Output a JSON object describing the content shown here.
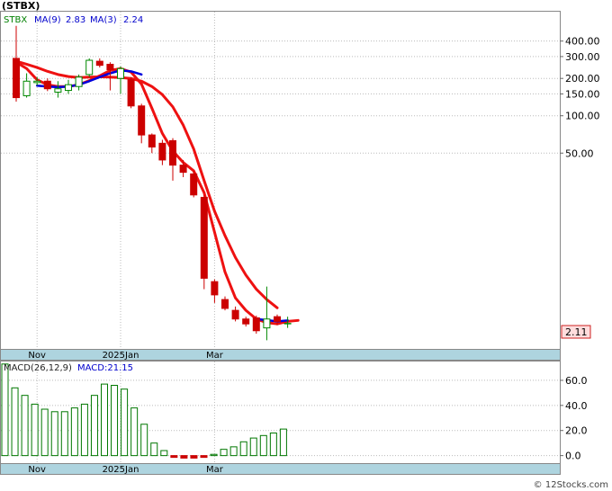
{
  "chart_data": [
    {
      "type": "candlestick",
      "title": "(STBX)",
      "legend": [
        {
          "label": "STBX",
          "value": "",
          "color": "#008000"
        },
        {
          "label": "MA(9)",
          "value": "2.83",
          "color": "#0000cc"
        },
        {
          "label": "MA(3)",
          "value": "2.24",
          "color": "#0000cc"
        }
      ],
      "y_scale": "log",
      "ylim": [
        1.32,
        690
      ],
      "y_ticks": [
        400,
        300,
        200,
        150,
        100,
        50
      ],
      "y_tick_labels": [
        "400.00",
        "300.00",
        "200.00",
        "150.00",
        "100.00",
        "50.00"
      ],
      "current_price_label": "2.11",
      "x_tick_labels": [
        {
          "label": "Nov",
          "bar": 2
        },
        {
          "label": "2025Jan",
          "bar": 10
        },
        {
          "label": "Mar",
          "bar": 19
        }
      ],
      "candles": [
        {
          "o": 290,
          "h": 530,
          "l": 130,
          "c": 140,
          "dir": "down"
        },
        {
          "o": 145,
          "h": 220,
          "l": 140,
          "c": 190,
          "dir": "up"
        },
        {
          "o": 185,
          "h": 205,
          "l": 175,
          "c": 190,
          "dir": "up"
        },
        {
          "o": 190,
          "h": 200,
          "l": 158,
          "c": 165,
          "dir": "down"
        },
        {
          "o": 155,
          "h": 190,
          "l": 140,
          "c": 165,
          "dir": "up"
        },
        {
          "o": 160,
          "h": 195,
          "l": 150,
          "c": 178,
          "dir": "up"
        },
        {
          "o": 172,
          "h": 215,
          "l": 160,
          "c": 205,
          "dir": "up"
        },
        {
          "o": 215,
          "h": 290,
          "l": 205,
          "c": 280,
          "dir": "up"
        },
        {
          "o": 275,
          "h": 290,
          "l": 245,
          "c": 255,
          "dir": "down"
        },
        {
          "o": 260,
          "h": 270,
          "l": 160,
          "c": 235,
          "dir": "down"
        },
        {
          "o": 240,
          "h": 250,
          "l": 150,
          "c": 200,
          "dir": "up"
        },
        {
          "o": 195,
          "h": 205,
          "l": 115,
          "c": 120,
          "dir": "down"
        },
        {
          "o": 120,
          "h": 125,
          "l": 60,
          "c": 70,
          "dir": "down"
        },
        {
          "o": 70,
          "h": 72,
          "l": 50,
          "c": 56,
          "dir": "down"
        },
        {
          "o": 60,
          "h": 64,
          "l": 40,
          "c": 44,
          "dir": "down"
        },
        {
          "o": 63,
          "h": 66,
          "l": 30,
          "c": 40,
          "dir": "down"
        },
        {
          "o": 40,
          "h": 44,
          "l": 32,
          "c": 35,
          "dir": "down"
        },
        {
          "o": 34,
          "h": 36,
          "l": 22,
          "c": 23,
          "dir": "down"
        },
        {
          "o": 22,
          "h": 23,
          "l": 4,
          "c": 4.9,
          "dir": "down"
        },
        {
          "o": 4.6,
          "h": 4.8,
          "l": 3.1,
          "c": 3.6,
          "dir": "down"
        },
        {
          "o": 3.3,
          "h": 3.5,
          "l": 2.7,
          "c": 2.8,
          "dir": "down"
        },
        {
          "o": 2.7,
          "h": 2.9,
          "l": 2.2,
          "c": 2.3,
          "dir": "down"
        },
        {
          "o": 2.3,
          "h": 2.4,
          "l": 2.0,
          "c": 2.1,
          "dir": "down"
        },
        {
          "o": 2.35,
          "h": 2.45,
          "l": 1.75,
          "c": 1.85,
          "dir": "down"
        },
        {
          "o": 1.95,
          "h": 4.2,
          "l": 1.55,
          "c": 2.3,
          "dir": "up"
        },
        {
          "o": 2.4,
          "h": 2.5,
          "l": 2.05,
          "c": 2.2,
          "dir": "down"
        },
        {
          "o": 2.15,
          "h": 2.4,
          "l": 1.95,
          "c": 2.11,
          "dir": "flat"
        }
      ],
      "series": [
        {
          "name": "MA(9)",
          "color": "#ee1111",
          "start_bar": 0,
          "values": [
            275,
            260,
            245,
            228,
            215,
            207,
            203,
            205,
            206,
            205,
            203,
            200,
            190,
            172,
            148,
            118,
            84,
            54,
            30,
            17,
            10.8,
            7.2,
            5.2,
            4.0,
            3.3,
            2.83
          ]
        },
        {
          "name": "MA(3)",
          "color": "#ee1111",
          "start_bar": 0,
          "values": [
            270,
            240,
            195,
            178,
            172,
            172,
            178,
            192,
            210,
            232,
            240,
            225,
            180,
            115,
            72,
            52,
            42,
            36,
            24,
            11.5,
            5.5,
            3.4,
            2.7,
            2.3,
            2.15,
            2.1,
            2.2,
            2.24
          ]
        },
        {
          "name": "trend-blue",
          "color": "#0000dd",
          "start_bar": 2,
          "values": [
            175,
            172,
            170,
            172,
            178,
            190,
            205,
            220,
            232,
            228,
            215
          ]
        },
        {
          "name": "trend-blue-2",
          "color": "#0000dd",
          "start_bar": 23,
          "values": [
            2.3,
            2.25,
            2.2,
            2.24
          ]
        }
      ]
    },
    {
      "type": "bar",
      "title": "",
      "legend": [
        {
          "label": "MACD(26,12,9)",
          "color": "#222222"
        },
        {
          "label": "MACD:21.15",
          "color": "#0000cc"
        }
      ],
      "ylim": [
        -6,
        75
      ],
      "y_ticks": [
        60,
        40,
        20,
        0
      ],
      "y_tick_labels": [
        "60.0",
        "40.0",
        "20.0",
        "0.0"
      ],
      "x_tick_labels": [
        {
          "label": "Nov",
          "bar": 2
        },
        {
          "label": "2025Jan",
          "bar": 10
        },
        {
          "label": "Mar",
          "bar": 19
        }
      ],
      "values": [
        73,
        54,
        48,
        41,
        37,
        35,
        35,
        38,
        41,
        48,
        57,
        56,
        53,
        38,
        25,
        10,
        4,
        -1,
        -2,
        -2,
        -1,
        1,
        5,
        7,
        11,
        14,
        16,
        18,
        21.15
      ]
    }
  ],
  "footer": {
    "text": "© 12Stocks.com"
  }
}
